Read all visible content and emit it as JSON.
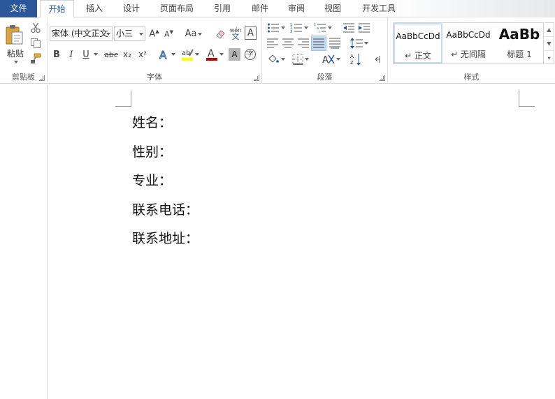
{
  "tabs": {
    "file": "文件",
    "home": "开始",
    "insert": "插入",
    "design": "设计",
    "layout": "页面布局",
    "references": "引用",
    "mailings": "邮件",
    "review": "审阅",
    "view": "视图",
    "developer": "开发工具"
  },
  "clipboard": {
    "paste_label": "粘贴",
    "group_label": "剪贴板"
  },
  "font": {
    "font_name": "宋体 (中文正文",
    "font_size": "小三",
    "change_case_label": "Aa",
    "phonetic_top": "wén",
    "phonetic_bottom": "文",
    "bold": "B",
    "italic": "I",
    "underline": "U",
    "strikethrough": "abc",
    "subscript": "x₂",
    "superscript": "x²",
    "enclose_char": "字",
    "char_border": "A",
    "char_shading": "A",
    "group_label": "字体",
    "font_color": "#c00000",
    "highlight_color": "#ffff00"
  },
  "paragraph": {
    "group_label": "段落"
  },
  "styles": {
    "group_label": "样式",
    "items": [
      {
        "sample": "AaBbCcDd",
        "name": "↵ 正文"
      },
      {
        "sample": "AaBbCcDd",
        "name": "↵ 无间隔"
      },
      {
        "sample": "AaBb",
        "name": "标题 1"
      }
    ]
  },
  "document": {
    "lines": [
      "姓名：",
      "性别：",
      "专业：",
      "联系电话：",
      "联系地址："
    ]
  },
  "colors": {
    "accent": "#2b579a",
    "selected_bg": "#c5dcf3"
  }
}
